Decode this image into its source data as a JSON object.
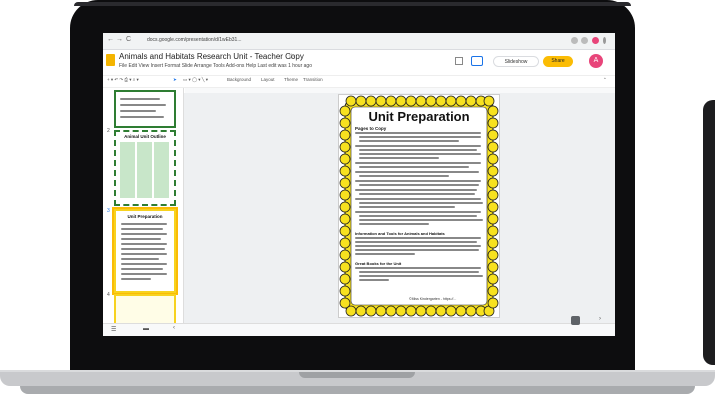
{
  "browser": {
    "url": "docs.google.com/presentation/d/1wEb31...",
    "nav_back": "←",
    "nav_forward": "→",
    "nav_reload": "C"
  },
  "doc": {
    "title": "Animals and Habitats Research Unit - Teacher Copy",
    "star": "☆",
    "menus": "File  Edit  View  Insert  Format  Slide  Arrange  Tools  Add-ons  Help   Last edit was 1 hour ago",
    "slideshow_label": "Slideshow",
    "share_label": "Share",
    "avatar_letter": "A"
  },
  "toolbar": {
    "background": "Background",
    "layout": "Layout",
    "theme": "Theme",
    "transition": "Transition"
  },
  "filmstrip": {
    "slide2_title": "Animal Unit Outline",
    "slide3_title": "Unit Preparation",
    "numbers": [
      "2",
      "3",
      "4"
    ]
  },
  "slide": {
    "title": "Unit Preparation",
    "section1": "Pages to Copy",
    "section2": "Information and Tools for Animals and Habitats",
    "section3": "Great Books for the Unit",
    "footer": "©Miss Kindergarten - https://..."
  },
  "colors": {
    "scallop_yellow": "#f7e11f",
    "green_border": "#2e7d32",
    "share_button": "#fbbc04",
    "avatar": "#e8457a"
  }
}
